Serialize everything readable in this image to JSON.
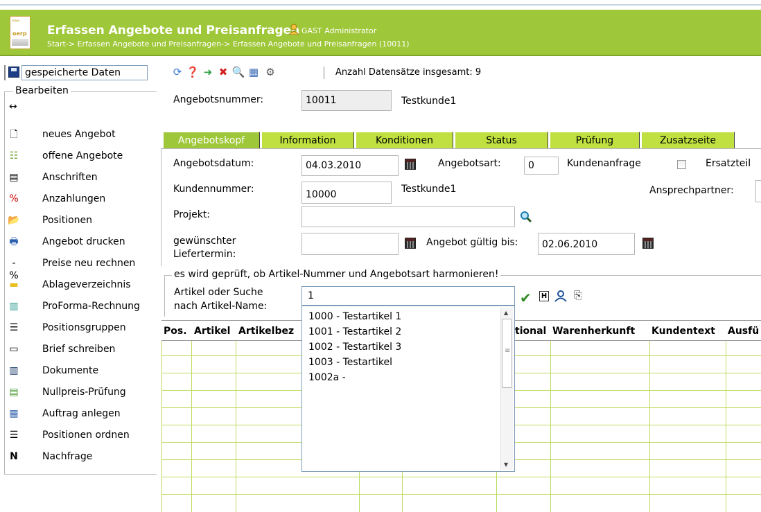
{
  "header": {
    "title": "Erfassen Angebote und Preisanfragen",
    "user": "GAST Administrator",
    "breadcrumb": "Start-> Erfassen Angebote und Preisanfragen-> Erfassen Angebote und Preisanfragen (10011)",
    "logo_text": "oerp"
  },
  "toolbar": {
    "data_select_value": "gespeicherte Daten",
    "record_count": "Anzahl Datensätze insgesamt: 9"
  },
  "sidebar": {
    "legend": "Bearbeiten",
    "items": [
      {
        "label": "neues Angebot",
        "icon": "page-icon"
      },
      {
        "label": "offene Angebote",
        "icon": "list-icon"
      },
      {
        "label": "Anschriften",
        "icon": "address-icon"
      },
      {
        "label": "Anzahlungen",
        "icon": "percent-icon"
      },
      {
        "label": "Positionen",
        "icon": "folder-open-icon"
      },
      {
        "label": "Angebot drucken",
        "icon": "print-icon"
      },
      {
        "label": "Preise neu rechnen",
        "icon": "recalc-icon"
      },
      {
        "label": "Ablageverzeichnis",
        "icon": "folder-icon"
      },
      {
        "label": "ProForma-Rechnung",
        "icon": "invoice-icon"
      },
      {
        "label": "Positionsgruppen",
        "icon": "groups-icon"
      },
      {
        "label": "Brief schreiben",
        "icon": "letter-icon"
      },
      {
        "label": "Dokumente",
        "icon": "documents-icon"
      },
      {
        "label": "Nullpreis-Prüfung",
        "icon": "check-icon"
      },
      {
        "label": "Auftrag anlegen",
        "icon": "order-icon"
      },
      {
        "label": "Positionen ordnen",
        "icon": "sort-icon"
      },
      {
        "label": "Nachfrage",
        "icon": "n-icon"
      }
    ]
  },
  "offer": {
    "number_label": "Angebotsnummer:",
    "number_value": "10011",
    "customer_name": "Testkunde1"
  },
  "tabs": [
    "Angebotskopf",
    "Information",
    "Konditionen",
    "Status",
    "Prüfung",
    "Zusatzseite"
  ],
  "form": {
    "date_label": "Angebotsdatum:",
    "date_value": "04.03.2010",
    "type_label": "Angebotsart:",
    "type_value": "0",
    "type_text": "Kundenanfrage",
    "spare_label": "Ersatzteil",
    "customer_no_label": "Kundennummer:",
    "customer_no_value": "10000",
    "customer_no_name": "Testkunde1",
    "contact_label": "Ansprechpartner:",
    "project_label": "Projekt:",
    "project_value": "",
    "delivery_label_1": "gewünschter",
    "delivery_label_2": "Liefertermin:",
    "delivery_value": "",
    "valid_label": "Angebot gültig bis:",
    "valid_value": "02.06.2010"
  },
  "article_search": {
    "legend": "es wird geprüft, ob Artikel-Nummer und Angebotsart harmonieren!",
    "label_1": "Artikel oder Suche",
    "label_2": "nach Artikel-Name:",
    "value": "1"
  },
  "suggestions": [
    "1000 - Testartikel 1",
    "1001 - Testartikel 2",
    "1002 - Testartikel 3",
    "1003 - Testartikel",
    "1002a -"
  ],
  "grid": {
    "headers": [
      "Pos.",
      "Artikel",
      "Artikelbez",
      "tional",
      "Warenherkunft",
      "Kundentext",
      "Ausfü"
    ]
  }
}
